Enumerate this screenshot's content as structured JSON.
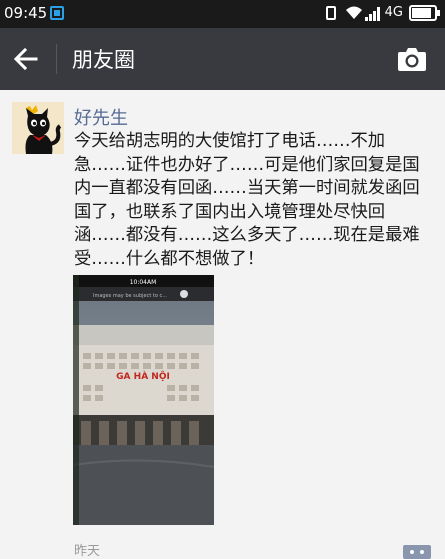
{
  "status_bar": {
    "time": "09:45",
    "network": "4G",
    "battery_level": 0.85,
    "icons": [
      "notification-icon",
      "vibrate-icon",
      "wifi-icon",
      "signal-icon",
      "battery-icon"
    ]
  },
  "header": {
    "title": "朋友圈",
    "back_icon": "arrow-left-icon",
    "camera_icon": "camera-icon",
    "background": "#393a3f"
  },
  "post": {
    "author": "好先生",
    "text": "今天给胡志明的大使馆打了电话……不加急……证件也办好了……可是他们家回复是国内一直都没有回函……当天第一时间就发函回国了，也联系了国内出入境管理处尽快回涵……都没有……这么多天了……现在是最难受……什么都不想做了！",
    "image": {
      "phone_status_time": "10:04AM",
      "search_placeholder": "Images may be subject to c...",
      "sign_text": "GA HÀ NỘI"
    },
    "timestamp": "昨天"
  },
  "colors": {
    "author_link": "#576b95",
    "feed_background": "#f3f3f3",
    "text": "#1a1a1a"
  }
}
